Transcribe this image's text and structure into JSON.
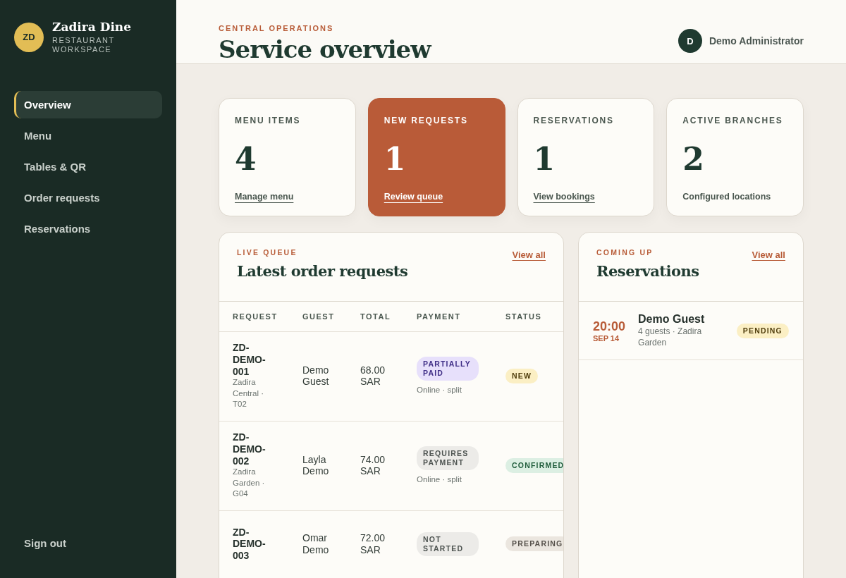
{
  "brand": {
    "initials": "ZD",
    "name": "Zadira Dine",
    "subtitle": "RESTAURANT WORKSPACE"
  },
  "nav": [
    {
      "label": "Overview",
      "selected": true
    },
    {
      "label": "Menu",
      "selected": false
    },
    {
      "label": "Tables & QR",
      "selected": false
    },
    {
      "label": "Order requests",
      "selected": false
    },
    {
      "label": "Reservations",
      "selected": false
    }
  ],
  "sign_out": "Sign out",
  "header": {
    "eyebrow": "CENTRAL OPERATIONS",
    "title": "Service overview",
    "user": {
      "initial": "D",
      "name": "Demo Administrator"
    }
  },
  "stats": [
    {
      "label": "MENU ITEMS",
      "value": "4",
      "footer": "Manage menu",
      "footer_is_link": true,
      "highlighted": false
    },
    {
      "label": "NEW REQUESTS",
      "value": "1",
      "footer": "Review queue",
      "footer_is_link": true,
      "highlighted": true
    },
    {
      "label": "RESERVATIONS",
      "value": "1",
      "footer": "View bookings",
      "footer_is_link": true,
      "highlighted": false
    },
    {
      "label": "ACTIVE BRANCHES",
      "value": "2",
      "footer": "Configured locations",
      "footer_is_link": false,
      "highlighted": false
    }
  ],
  "orders": {
    "eyebrow": "LIVE QUEUE",
    "title": "Latest order requests",
    "view_all": "View all",
    "columns": [
      "REQUEST",
      "GUEST",
      "TOTAL",
      "PAYMENT",
      "STATUS"
    ],
    "rows": [
      {
        "request": "ZD-DEMO-001",
        "location": "Zadira Central · T02",
        "guest": "Demo Guest",
        "total": "68.00 SAR",
        "payment": {
          "label": "PARTIALLY PAID",
          "kind": "partial",
          "detail": "Online · split"
        },
        "status": {
          "label": "NEW",
          "kind": "new"
        }
      },
      {
        "request": "ZD-DEMO-002",
        "location": "Zadira Garden · G04",
        "guest": "Layla Demo",
        "total": "74.00 SAR",
        "payment": {
          "label": "REQUIRES PAYMENT",
          "kind": "neutral",
          "detail": "Online · split"
        },
        "status": {
          "label": "CONFIRMED",
          "kind": "confirmed"
        }
      },
      {
        "request": "ZD-DEMO-003",
        "guest": "Omar Demo",
        "total": "72.00 SAR",
        "payment": {
          "label": "NOT STARTED",
          "kind": "neutral"
        },
        "status": {
          "label": "PREPARING",
          "kind": "preparing"
        }
      }
    ]
  },
  "reservations": {
    "eyebrow": "COMING UP",
    "title": "Reservations",
    "view_all": "View all",
    "items": [
      {
        "time": "20:00",
        "date": "SEP 14",
        "guest": "Demo Guest",
        "detail": "4 guests · Zadira Garden",
        "status": {
          "label": "PENDING",
          "kind": "pending"
        }
      }
    ]
  }
}
